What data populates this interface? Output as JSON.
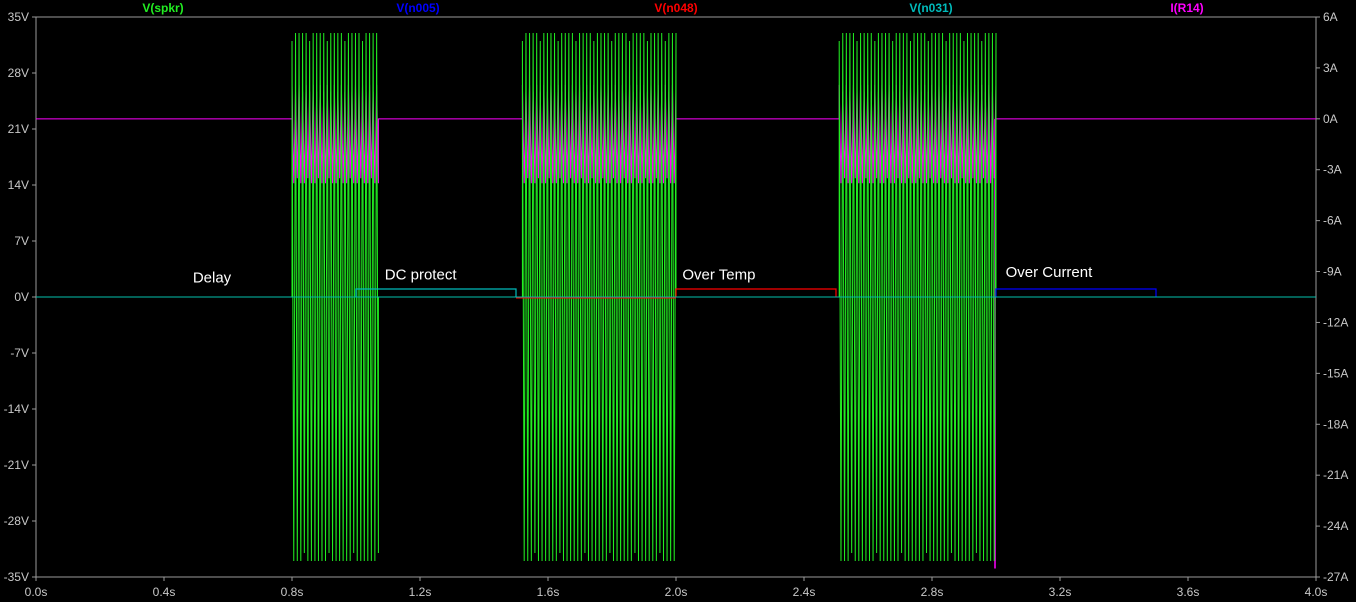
{
  "chart_data": {
    "type": "line",
    "title": "",
    "traces": [
      {
        "name": "V(spkr)",
        "color": "#22ee22"
      },
      {
        "name": "V(n005)",
        "color": "#0000ff"
      },
      {
        "name": "V(n048)",
        "color": "#ff0000"
      },
      {
        "name": "V(n031)",
        "color": "#00bbbb"
      },
      {
        "name": "I(R14)",
        "color": "#ff00ff"
      }
    ],
    "x_axis": {
      "range": [
        0,
        4.0
      ],
      "ticks": [
        "0.0s",
        "0.4s",
        "0.8s",
        "1.2s",
        "1.6s",
        "2.0s",
        "2.4s",
        "2.8s",
        "3.2s",
        "3.6s",
        "4.0s"
      ]
    },
    "y_axis_left": {
      "range": [
        -35,
        35
      ],
      "ticks": [
        "35V",
        "28V",
        "21V",
        "14V",
        "7V",
        "0V",
        "-7V",
        "-14V",
        "-21V",
        "-28V",
        "-35V"
      ]
    },
    "y_axis_right": {
      "range": [
        -27,
        6
      ],
      "ticks": [
        "6A",
        "3A",
        "0A",
        "-3A",
        "-6A",
        "-9A",
        "-12A",
        "-15A",
        "-18A",
        "-21A",
        "-24A",
        "-27A"
      ]
    },
    "bursts": [
      {
        "start": 0.8,
        "end": 1.07,
        "vspkr_max": 33,
        "vspkr_min": -33,
        "ir14_max": 2.0,
        "ir14_min": -3.8
      },
      {
        "start": 1.52,
        "end": 2.0,
        "vspkr_max": 33,
        "vspkr_min": -33,
        "ir14_max": 2.0,
        "ir14_min": -3.8
      },
      {
        "start": 2.51,
        "end": 3.0,
        "vspkr_max": 33,
        "vspkr_min": -33,
        "ir14_max": 2.0,
        "ir14_min": -3.8
      }
    ],
    "steps": [
      {
        "trace": "V(n031)",
        "start": 1.0,
        "end": 1.5,
        "level": 1.0
      },
      {
        "trace": "V(n048)",
        "start": 2.0,
        "end": 2.5,
        "level": 1.0
      },
      {
        "trace": "V(n005)",
        "start": 3.0,
        "end": 3.5,
        "level": 1.0
      }
    ],
    "ir14_baseline": 0,
    "annotations": [
      {
        "text": "Delay",
        "x": 0.55,
        "y": 1.8
      },
      {
        "text": "DC protect",
        "x": 1.09,
        "y": 2.2
      },
      {
        "text": "Over Temp",
        "x": 2.02,
        "y": 2.2
      },
      {
        "text": "Over Current",
        "x": 3.03,
        "y": 2.5
      }
    ]
  }
}
